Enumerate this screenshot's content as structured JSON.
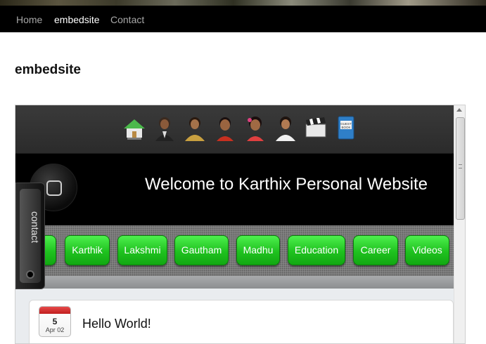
{
  "nav": {
    "items": [
      {
        "label": "Home",
        "active": false
      },
      {
        "label": "embedsite",
        "active": true
      },
      {
        "label": "Contact",
        "active": false
      }
    ]
  },
  "page": {
    "title": "embedsite"
  },
  "embed": {
    "icons": [
      "home-icon",
      "person-icon",
      "person-icon",
      "person-icon",
      "person-icon",
      "person-icon",
      "video-clapper-icon",
      "guest-book-icon"
    ],
    "welcome_text": "Welcome to Karthix Personal Website",
    "menu": [
      "",
      "Karthik",
      "Lakshmi",
      "Gautham",
      "Madhu",
      "Education",
      "Career",
      "Videos"
    ],
    "contact_label": "contact",
    "post": {
      "calendar_day": "5",
      "calendar_date": "Apr 02",
      "title": "Hello World!"
    },
    "colors": {
      "button_green": "#1fc21f",
      "calendar_red": "#d23030"
    }
  }
}
